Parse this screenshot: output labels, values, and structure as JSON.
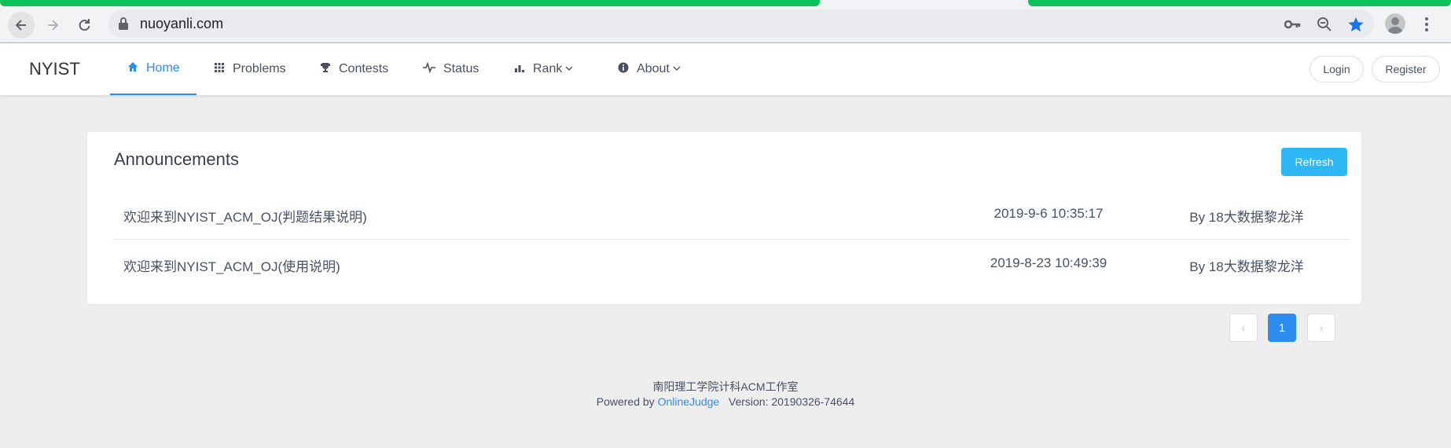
{
  "browser": {
    "url": "nuoyanli.com",
    "icons": [
      "back-arrow-icon",
      "forward-arrow-icon",
      "reload-icon",
      "lock-icon",
      "key-icon",
      "zoom-out-icon",
      "bookmark-star-icon",
      "profile-avatar-icon",
      "more-menu-icon"
    ],
    "accent_progress": "#0bc15a"
  },
  "navbar": {
    "logo": "NYIST",
    "items": [
      {
        "label": "Home",
        "icon": "home-icon",
        "active": true
      },
      {
        "label": "Problems",
        "icon": "grid-icon"
      },
      {
        "label": "Contests",
        "icon": "trophy-icon"
      },
      {
        "label": "Status",
        "icon": "pulse-icon"
      },
      {
        "label": "Rank",
        "icon": "bar-chart-icon",
        "dropdown": true
      },
      {
        "label": "About",
        "icon": "info-icon",
        "dropdown": true
      }
    ],
    "login": "Login",
    "register": "Register"
  },
  "announcements": {
    "title": "Announcements",
    "refresh": "Refresh",
    "rows": [
      {
        "title": "欢迎来到NYIST_ACM_OJ(判题结果说明)",
        "date": "2019-9-6 10:35:17",
        "author": "By 18大数据黎龙洋"
      },
      {
        "title": "欢迎来到NYIST_ACM_OJ(使用说明)",
        "date": "2019-8-23 10:49:39",
        "author": "By 18大数据黎龙洋"
      }
    ]
  },
  "pagination": {
    "current": "1",
    "prev": "‹",
    "next": "›"
  },
  "footer": {
    "line1": "南阳理工学院计科ACM工作室",
    "powered": "Powered by",
    "oj": "OnlineJudge",
    "version": "Version: 20190326-74644"
  },
  "colors": {
    "primary": "#2d8cf0",
    "info": "#2db7f5",
    "background": "#eeeeee"
  }
}
